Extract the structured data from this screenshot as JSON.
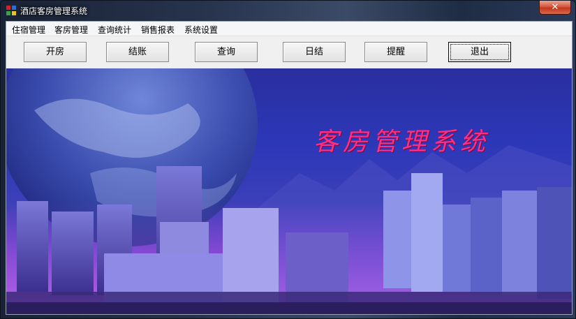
{
  "window": {
    "title": "酒店客房管理系统",
    "close_label": "✕"
  },
  "menu": {
    "items": [
      "住宿管理",
      "客房管理",
      "查询统计",
      "销售报表",
      "系统设置"
    ]
  },
  "toolbar": {
    "open_room": "开房",
    "checkout": "结账",
    "query": "查询",
    "daily_close": "日结",
    "reminder": "提醒",
    "exit": "退出"
  },
  "banner": {
    "title": "客房管理系统"
  },
  "colors": {
    "banner_title": "#ff2e85",
    "banner_sky": "#2c37b8"
  }
}
